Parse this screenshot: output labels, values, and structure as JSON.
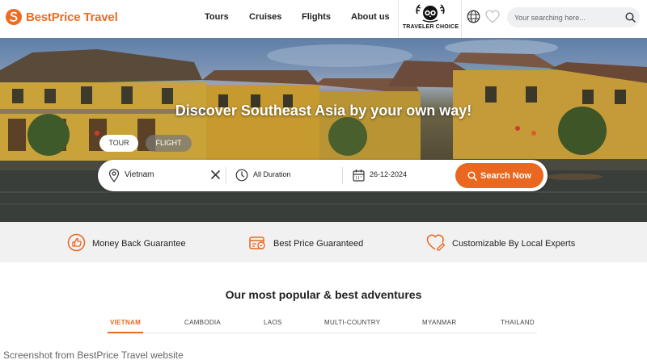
{
  "brand": {
    "name": "BestPrice Travel",
    "color": "#ee6c22"
  },
  "nav": {
    "items": [
      "Tours",
      "Cruises",
      "Flights",
      "About us"
    ]
  },
  "traveler_choice": {
    "label": "TRAVELER CHOICE"
  },
  "icons": {
    "language": "globe-icon",
    "wishlist": "heart-icon",
    "search": "search-icon"
  },
  "search": {
    "placeholder": "Your searching here..."
  },
  "hero": {
    "title": "Discover Southeast Asia by your own way!",
    "tabs": {
      "tour": "TOUR",
      "flight": "FLIGHT"
    },
    "destination": "Vietnam",
    "duration": "All Duration",
    "date": "26-12-2024",
    "search_button": "Search Now"
  },
  "features": [
    {
      "label": "Money Back Guarantee",
      "icon": "money-back-icon"
    },
    {
      "label": "Best Price Guaranteed",
      "icon": "price-tag-icon"
    },
    {
      "label": "Customizable By Local Experts",
      "icon": "heart-edit-icon"
    }
  ],
  "adventures": {
    "title": "Our most popular & best adventures",
    "tabs": [
      "VIETNAM",
      "CAMBODIA",
      "LAOS",
      "MULTI-COUNTRY",
      "MYANMAR",
      "THAILAND"
    ],
    "active_tab": "VIETNAM"
  },
  "caption": "Screenshot from BestPrice Travel website",
  "colors": {
    "accent": "#e9671f",
    "feature_band": "#f1f1f1",
    "search_field": "#eef0f2"
  }
}
